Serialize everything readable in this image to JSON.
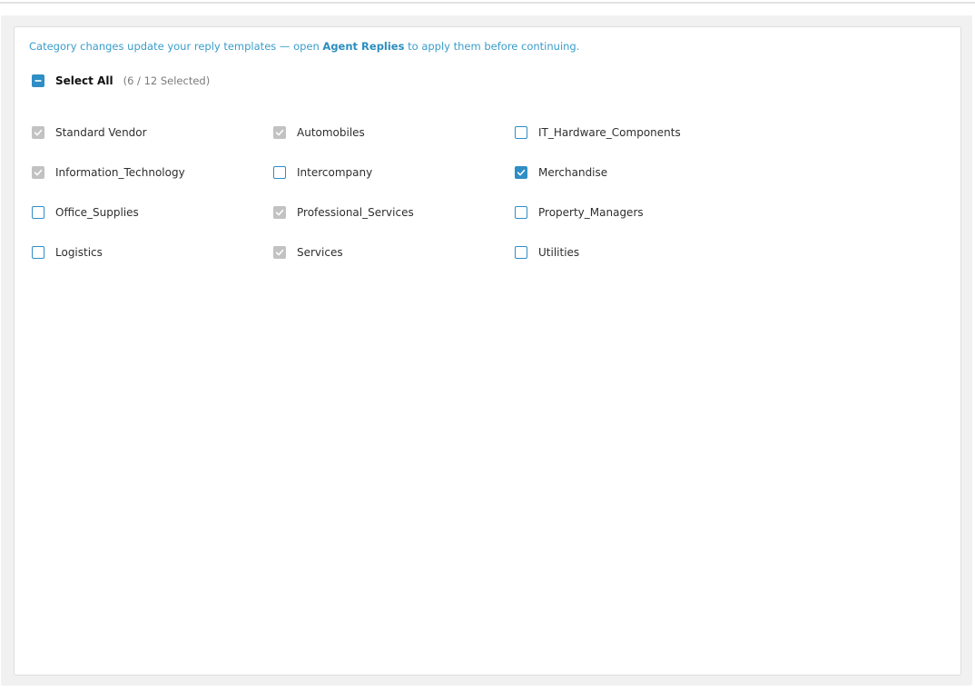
{
  "notice": {
    "prefix": "Category changes update your reply templates — open ",
    "link": "Agent Replies",
    "suffix": " to apply them before continuing."
  },
  "select_all": {
    "label": "Select All",
    "count": "(6 / 12 Selected)",
    "state": "indeterminate"
  },
  "categories": [
    {
      "label": "Standard Vendor",
      "state": "checked-disabled"
    },
    {
      "label": "Automobiles",
      "state": "checked-disabled"
    },
    {
      "label": "IT_Hardware_Components",
      "state": "unchecked"
    },
    {
      "label": "Information_Technology",
      "state": "checked-disabled"
    },
    {
      "label": "Intercompany",
      "state": "unchecked"
    },
    {
      "label": "Merchandise",
      "state": "checked"
    },
    {
      "label": "Office_Supplies",
      "state": "unchecked"
    },
    {
      "label": "Professional_Services",
      "state": "checked-disabled"
    },
    {
      "label": "Property_Managers",
      "state": "unchecked"
    },
    {
      "label": "Logistics",
      "state": "unchecked"
    },
    {
      "label": "Services",
      "state": "checked-disabled"
    },
    {
      "label": "Utilities",
      "state": "unchecked"
    }
  ],
  "colors": {
    "accent": "#2f8ec5",
    "notice_text": "#3a9dc9",
    "disabled": "#c2c2c2"
  }
}
